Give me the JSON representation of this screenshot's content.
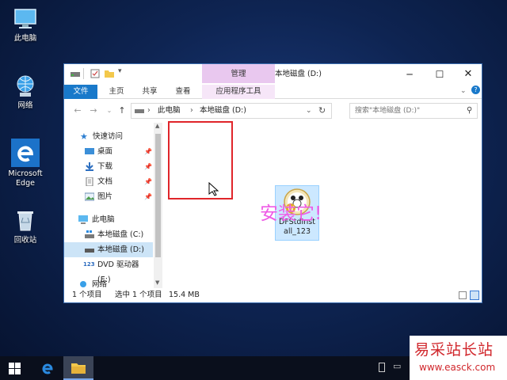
{
  "desktop": {
    "icons": [
      {
        "label": "此电脑",
        "icon": "computer-icon"
      },
      {
        "label": "网络",
        "icon": "network-icon"
      },
      {
        "label": "Microsoft Edge",
        "icon": "edge-icon"
      },
      {
        "label": "回收站",
        "icon": "recycle-bin-icon"
      }
    ]
  },
  "window": {
    "title": "本地磁盘 (D:)",
    "context_group": "管理",
    "controls": {
      "minimize": "─",
      "maximize": "☐",
      "close": "✕"
    },
    "ribbon_tabs": [
      "文件",
      "主页",
      "共享",
      "查看",
      "应用程序工具"
    ],
    "address": {
      "segments": [
        "此电脑",
        "本地磁盘 (D:)"
      ],
      "separator": "›"
    },
    "search_placeholder": "搜索\"本地磁盘 (D:)\"",
    "nav": {
      "quick_access": "快速访问",
      "items": [
        "桌面",
        "下载",
        "文档",
        "图片"
      ],
      "this_pc": "此电脑",
      "drives": [
        "本地磁盘 (C:)",
        "本地磁盘 (D:)",
        "DVD 驱动器 (E:)"
      ],
      "network": "网络"
    },
    "file": {
      "name_line1": "DFStdInst",
      "name_line2": "all_123"
    },
    "status": {
      "count": "1 个项目",
      "selected": "选中 1 个项目",
      "size": "15.4 MB"
    }
  },
  "annotation": "安装它!",
  "watermark": {
    "line1": "易采站长站",
    "line2": "www.easck.com"
  },
  "colors": {
    "accent": "#1979ca",
    "context_tab": "#e9c8ef",
    "highlight": "#e0252a",
    "annotation": "#ee5be6"
  }
}
